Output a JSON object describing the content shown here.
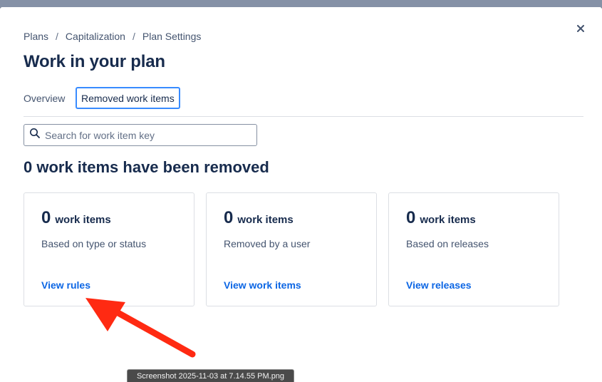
{
  "breadcrumb": {
    "items": [
      "Plans",
      "Capitalization",
      "Plan Settings"
    ],
    "separator": "/"
  },
  "title": "Work in your plan",
  "close_icon": "close-icon",
  "tabs": [
    {
      "label": "Overview",
      "selected": false
    },
    {
      "label": "Removed work items",
      "selected": true
    }
  ],
  "search": {
    "placeholder": "Search for work item key",
    "value": "",
    "icon": "search-icon"
  },
  "summary_heading": "0 work items have been removed",
  "cards": [
    {
      "count": "0",
      "unit": "work items",
      "description": "Based on type or status",
      "link": "View rules"
    },
    {
      "count": "0",
      "unit": "work items",
      "description": "Removed by a user",
      "link": "View work items"
    },
    {
      "count": "0",
      "unit": "work items",
      "description": "Based on releases",
      "link": "View releases"
    }
  ],
  "annotation": {
    "arrow_color": "#ff2a12",
    "arrow_target": "View rules"
  },
  "screenshot_label": "Screenshot 2025-11-03 at 7.14.55 PM.png",
  "colors": {
    "link": "#0c66e4",
    "text": "#172b4d",
    "subtle_text": "#44546f",
    "tab_focus": "#388bff",
    "border": "#dcdfe4"
  }
}
